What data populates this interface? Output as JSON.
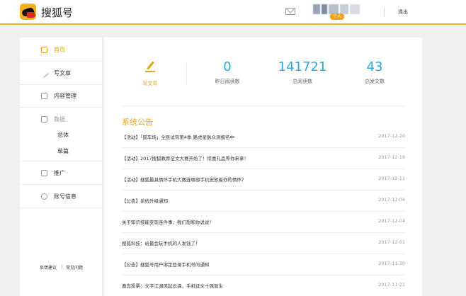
{
  "header": {
    "brand": "搜狐号",
    "user_badge": "个人",
    "logout": "退出"
  },
  "sidebar": {
    "items": [
      {
        "label": "首页",
        "icon": "home-icon"
      },
      {
        "label": "写文章",
        "icon": "pen-icon"
      },
      {
        "label": "内容管理",
        "icon": "document-icon"
      },
      {
        "label": "数据",
        "icon": "chart-icon"
      },
      {
        "label": "推广",
        "icon": "megaphone-icon"
      },
      {
        "label": "账号信息",
        "icon": "gear-icon"
      }
    ],
    "sub_items": [
      "总体",
      "单篇"
    ],
    "footer_links": [
      "反馈建议",
      "常见问题"
    ]
  },
  "stats": {
    "write_label": "写文章",
    "items": [
      {
        "value": "0",
        "label": "昨日阅读数"
      },
      {
        "value": "141721",
        "label": "总阅读数"
      },
      {
        "value": "43",
        "label": "总发文数"
      }
    ]
  },
  "notices": {
    "title": "系统公告",
    "rows": [
      {
        "text": "【活动】「狐车场」全民试驾第4季 路虎星脉众测报名中",
        "date": "2017-12-20"
      },
      {
        "text": "【活动】2017搜狐教育征文大赛开始了！惊喜礼品等你来拿！",
        "date": "2017-12-18"
      },
      {
        "text": "【活动】搜狐最具情怀手机大赛连哪部手机安放着你的情怀？",
        "date": "2017-12-11"
      },
      {
        "text": "【公告】系统升级通知",
        "date": "2017-12-04"
      },
      {
        "text": "关于知识技能变现连件事，我们想和你说说！",
        "date": "2017-12-04"
      },
      {
        "text": "搜狐科技：给最会玩手机的人发钱了！",
        "date": "2017-12-01"
      },
      {
        "text": "【公告】搜狐号用户绑定登录手机号的通知",
        "date": "2017-11-30"
      },
      {
        "text": "邀您投票：文字江湖风起云涌，手机征文十强诞生",
        "date": "2017-11-21"
      }
    ]
  },
  "colors": {
    "accent": "#e8a519",
    "number": "#2aa8e1"
  }
}
